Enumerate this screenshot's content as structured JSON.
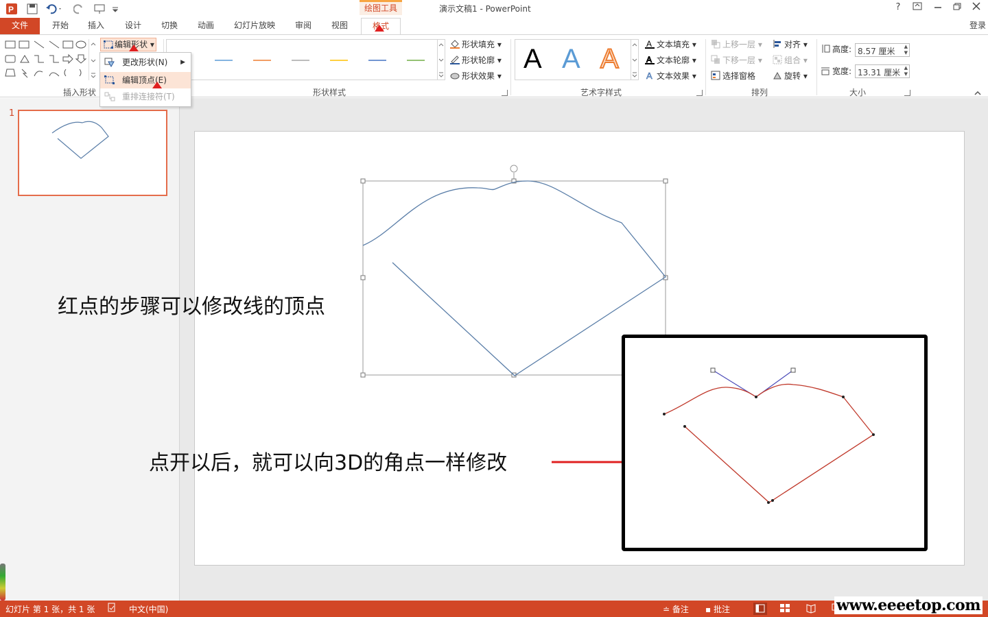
{
  "titlebar": {
    "context_tab": "绘图工具",
    "doc_title": "演示文稿1 - PowerPoint",
    "help": "?",
    "login": "登录"
  },
  "tabs": [
    "文件",
    "开始",
    "插入",
    "设计",
    "切换",
    "动画",
    "幻灯片放映",
    "审阅",
    "视图",
    "格式"
  ],
  "ribbon": {
    "insert_shapes": {
      "label": "插入形状",
      "edit_shape": "编辑形状",
      "menu": {
        "change_shape": "更改形状(N)",
        "edit_points": "编辑顶点(E)",
        "reroute": "重排连接符(T)"
      }
    },
    "shape_styles": {
      "label": "形状样式",
      "fill": "形状填充",
      "outline": "形状轮廓",
      "effects": "形状效果",
      "line_colors": [
        "#5b9bd5",
        "#ed7d31",
        "#a5a5a5",
        "#ffc000",
        "#4472c4",
        "#70ad47"
      ]
    },
    "wordart": {
      "label": "艺术字样式",
      "glyph": "A",
      "text_fill": "文本填充",
      "text_outline": "文本轮廓",
      "text_effects": "文本效果"
    },
    "arrange": {
      "label": "排列",
      "bring_forward": "上移一层",
      "send_backward": "下移一层",
      "selection_pane": "选择窗格",
      "align": "对齐",
      "group": "组合",
      "rotate": "旋转"
    },
    "size": {
      "label": "大小",
      "height_label": "高度:",
      "height_value": "8.57 厘米",
      "width_label": "宽度:",
      "width_value": "13.31 厘米"
    }
  },
  "thumbnails": {
    "slide_number": "1"
  },
  "slide": {
    "annotation_1": "红点的步骤可以修改线的顶点",
    "annotation_2": "点开以后，就可以向3D的角点一样修改"
  },
  "statusbar": {
    "slide_info": "幻灯片 第 1 张，共 1 张",
    "language": "中文(中国)",
    "notes": "备注",
    "comments": "批注",
    "watermark": "www.eeeetop.com"
  },
  "colors": {
    "accent": "#d24726",
    "shape_line": "#5a7ea8",
    "edit_path": "#c0392b"
  }
}
